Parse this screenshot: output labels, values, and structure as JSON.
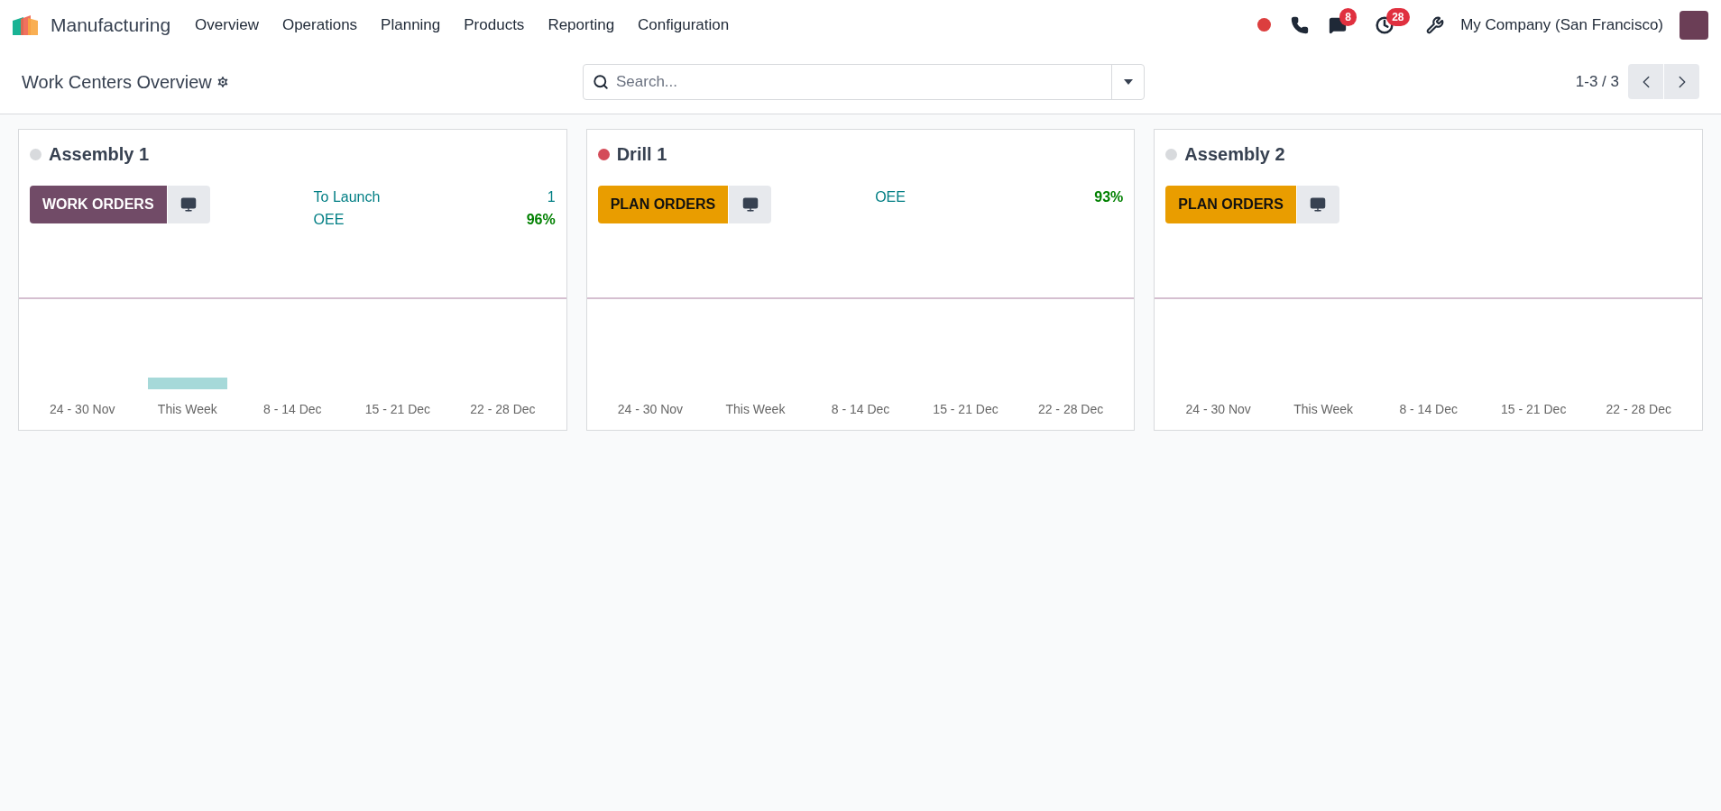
{
  "app": {
    "name": "Manufacturing"
  },
  "menu": [
    "Overview",
    "Operations",
    "Planning",
    "Products",
    "Reporting",
    "Configuration"
  ],
  "systray": {
    "messages_count": "8",
    "activities_count": "28",
    "company": "My Company (San Francisco)"
  },
  "control_panel": {
    "title": "Work Centers Overview",
    "search": {
      "placeholder": "Search..."
    },
    "pager": "1-3 / 3"
  },
  "cards": [
    {
      "name": "Assembly 1",
      "color": "#d8dadd",
      "button": {
        "kind": "work_orders",
        "label": "WORK ORDERS"
      },
      "stats": [
        {
          "label": "To Launch",
          "value": "1",
          "emphasis": false
        },
        {
          "label": "OEE",
          "value": "96%",
          "emphasis": true
        }
      ],
      "weeks": [
        {
          "label": "24 - 30 Nov",
          "bar": false
        },
        {
          "label": "This Week",
          "bar": true
        },
        {
          "label": "8 - 14 Dec",
          "bar": false
        },
        {
          "label": "15 - 21 Dec",
          "bar": false
        },
        {
          "label": "22 - 28 Dec",
          "bar": false
        }
      ]
    },
    {
      "name": "Drill 1",
      "color": "#d44c59",
      "button": {
        "kind": "plan_orders",
        "label": "PLAN ORDERS"
      },
      "stats": [
        {
          "label": "OEE",
          "value": "93%",
          "emphasis": true
        }
      ],
      "weeks": [
        {
          "label": "24 - 30 Nov",
          "bar": false
        },
        {
          "label": "This Week",
          "bar": false
        },
        {
          "label": "8 - 14 Dec",
          "bar": false
        },
        {
          "label": "15 - 21 Dec",
          "bar": false
        },
        {
          "label": "22 - 28 Dec",
          "bar": false
        }
      ]
    },
    {
      "name": "Assembly 2",
      "color": "#d8dadd",
      "button": {
        "kind": "plan_orders",
        "label": "PLAN ORDERS"
      },
      "weeks": [
        {
          "label": "24 - 30 Nov",
          "bar": false
        },
        {
          "label": "This Week",
          "bar": false
        },
        {
          "label": "8 - 14 Dec",
          "bar": false
        },
        {
          "label": "15 - 21 Dec",
          "bar": false
        },
        {
          "label": "22 - 28 Dec",
          "bar": false
        }
      ]
    }
  ]
}
